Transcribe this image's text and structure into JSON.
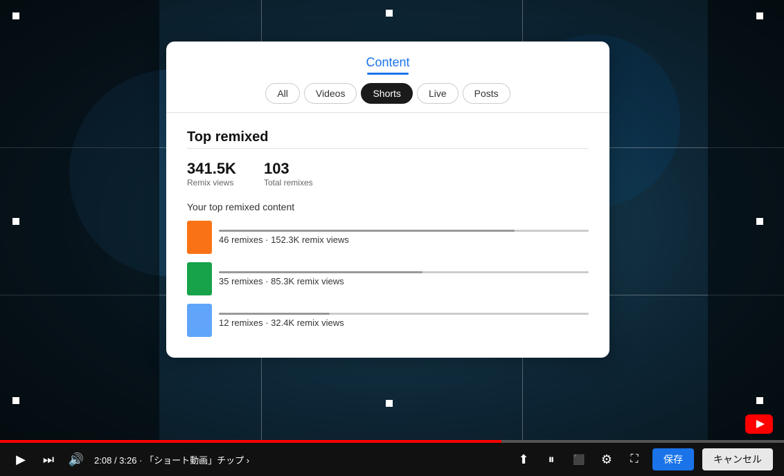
{
  "video": {
    "bg_color": "#1a3a4a",
    "time_current": "2:08",
    "time_total": "3:26",
    "chapter_label": "「ショート動画」チップ",
    "progress_percent": 64
  },
  "modal": {
    "title": "Content",
    "tabs": [
      {
        "id": "all",
        "label": "All",
        "active": false
      },
      {
        "id": "videos",
        "label": "Videos",
        "active": false
      },
      {
        "id": "shorts",
        "label": "Shorts",
        "active": true
      },
      {
        "id": "live",
        "label": "Live",
        "active": false
      },
      {
        "id": "posts",
        "label": "Posts",
        "active": false
      }
    ],
    "section_title": "Top remixed",
    "stats": [
      {
        "value": "341.5K",
        "label": "Remix views"
      },
      {
        "value": "103",
        "label": "Total remixes"
      }
    ],
    "top_remixed_label": "Your top remixed content",
    "content_items": [
      {
        "bar_width": "80%",
        "stats": "46 remixes · 152.3K remix views",
        "thumb_class": "thumb-orange"
      },
      {
        "bar_width": "55%",
        "stats": "35 remixes · 85.3K remix views",
        "thumb_class": "thumb-green"
      },
      {
        "bar_width": "30%",
        "stats": "12 remixes · 32.4K remix views",
        "thumb_class": "thumb-blue"
      }
    ]
  },
  "controls": {
    "play_icon": "▶",
    "skip_icon": "⏭",
    "volume_icon": "🔊",
    "time_separator": "/",
    "chapter_dot": "·",
    "chapter_arrow": "›",
    "upload_icon": "⬆",
    "pause_icon": "⏸",
    "captions_icon": "⬜",
    "settings_icon": "⚙",
    "fullscreen_icon": "⤢",
    "save_label": "保存",
    "cancel_label": "キャンセル"
  }
}
